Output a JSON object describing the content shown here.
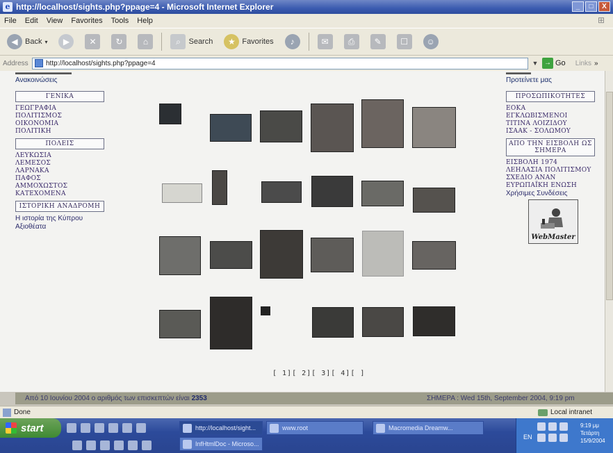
{
  "window": {
    "title": "http://localhost/sights.php?ppage=4 - Microsoft Internet Explorer",
    "controls": [
      "_",
      "□",
      "X"
    ]
  },
  "menu": [
    "File",
    "Edit",
    "View",
    "Favorites",
    "Tools",
    "Help"
  ],
  "toolbar": {
    "back": "Back",
    "search": "Search",
    "favorites": "Favorites"
  },
  "address": {
    "label": "Address",
    "url": "http://localhost/sights.php?ppage=4",
    "go": "Go",
    "links": "Links"
  },
  "left_nav": {
    "top_link": "Ανακοινώσεις",
    "sections": [
      {
        "title": "ΓΕΝΙΚΑ",
        "items": [
          "ΓΕΩΓΡΑΦΙΑ",
          "ΠΟΛΙΤΙΣΜΟΣ",
          "ΟΙΚΟΝΟΜΙΑ",
          "ΠΟΛΙΤΙΚΗ"
        ]
      },
      {
        "title": "ΠΟΛΕΙΣ",
        "items": [
          "ΛΕΥΚΩΣΙΑ",
          "ΛΕΜΕΣΟΣ",
          "ΛΑΡΝΑΚΑ",
          "ΠΑΦΟΣ",
          "ΑΜΜΟΧΩΣΤΟΣ",
          "ΚΑΤΕΧΟΜΕΝΑ"
        ]
      },
      {
        "title": "ΙΣΤΟΡΙΚΗ ΑΝΑΔΡΟΜΗ",
        "items": [
          "Η ιστορία της Κύπρου",
          "Αξιοθέατα"
        ]
      }
    ]
  },
  "right_nav": {
    "top_link": "Προτείνετε μας",
    "sections": [
      {
        "title": "ΠΡΟΣΩΠΙΚΟΤΗΤΕΣ",
        "items": [
          "ΕΟΚΑ",
          "ΕΓΚΛΩΒΙΣΜΕΝΟΙ",
          "ΤΙΤΙΝΑ ΛΟΙΖΙΔΟΥ",
          "ΙΣΑΑΚ - ΣΟΛΩΜΟΥ"
        ]
      },
      {
        "title": "ΑΠΟ ΤΗΝ ΕΙΣΒΟΛΗ ΩΣ ΣΗΜΕΡΑ",
        "items": [
          "ΕΙΣΒΟΛΗ 1974",
          "ΛΕΗΛΑΣΙΑ ΠΟΛΙΤΙΣΜΟΥ",
          "ΣΧΕΔΙΟ ΑΝΑΝ",
          "ΕΥΡΩΠΑΪΚΗ ΕΝΩΣΗ",
          "Χρήσιμες Συνδέσεις"
        ]
      }
    ],
    "webmaster": "WebMaster"
  },
  "gallery": {
    "pagination": "[ 1][ 2][ 3][ 4][ ]"
  },
  "page_footer": {
    "left_prefix": "Από 10 Ιουνίου 2004 ο αριθμός των επισκεπτών είναι",
    "visitor_count": "2353",
    "right": "ΣΗΜΕΡΑ : Wed 15th, September 2004, 9:19 pm"
  },
  "status": {
    "left": "Done",
    "zone": "Local intranet"
  },
  "taskbar": {
    "start": "start",
    "tasks": [
      "http://localhost/sight...",
      "www.root",
      "Macromedia Dreamw...",
      "InfHtmlDoc - Microso..."
    ],
    "lang": "EN",
    "clock": [
      "9:19 μμ",
      "Τετάρτη",
      "15/9/2004"
    ]
  }
}
